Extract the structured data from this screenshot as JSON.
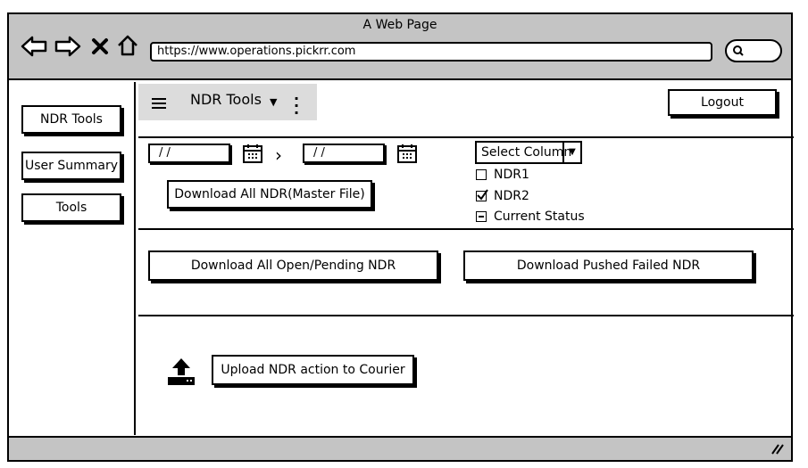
{
  "window": {
    "title": "A Web Page",
    "url": "https://www.operations.pickrr.com"
  },
  "nav_icons": [
    "back-arrow-icon",
    "forward-arrow-icon",
    "close-x-icon",
    "home-icon"
  ],
  "sidebar": {
    "items": [
      {
        "label": "NDR Tools"
      },
      {
        "label": "User Summary"
      },
      {
        "label": "Tools"
      }
    ]
  },
  "header": {
    "title": "NDR Tools",
    "logout_label": "Logout"
  },
  "date_filter": {
    "from_value": "/ /",
    "to_value": "/ /"
  },
  "column_select": {
    "label": "Select Column",
    "options": [
      {
        "label": "NDR1",
        "state": "unchecked"
      },
      {
        "label": "NDR2",
        "state": "checked"
      },
      {
        "label": "Current Status",
        "state": "indeterminate"
      }
    ]
  },
  "buttons": {
    "download_master": "Download All NDR(Master File)",
    "download_open_pending": "Download All Open/Pending NDR",
    "download_pushed_failed": "Download Pushed Failed NDR",
    "upload_action": "Upload NDR action to Courier"
  },
  "colors": {
    "chrome_gray": "#c4c4c4",
    "header_panel": "#dcdcdc"
  }
}
